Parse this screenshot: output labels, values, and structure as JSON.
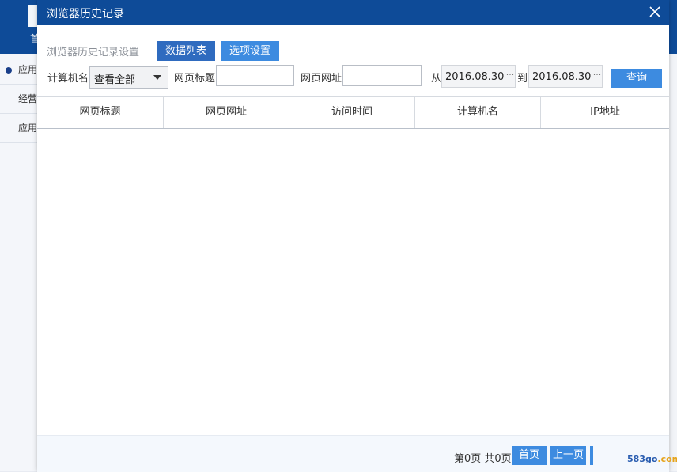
{
  "background": {
    "home_label": "首",
    "sidebar_items": [
      {
        "label": "应用"
      },
      {
        "label": "经营"
      },
      {
        "label": "应用"
      }
    ]
  },
  "dialog": {
    "title": "浏览器历史记录",
    "close_icon": "close-icon",
    "settings_label": "浏览器历史记录设置",
    "tabs": [
      {
        "label": "数据列表",
        "active": true
      },
      {
        "label": "选项设置",
        "active": false
      }
    ],
    "filters": {
      "computer_label": "计算机名",
      "computer_value": "查看全部",
      "page_title_label": "网页标题",
      "page_title_value": "",
      "page_url_label": "网页网址",
      "page_url_value": "",
      "from_label": "从",
      "from_date": "2016.08.30",
      "to_label": "到",
      "to_date": "2016.08.30",
      "date_picker_glyph": "···",
      "query_label": "查询"
    },
    "table": {
      "columns": [
        "网页标题",
        "网页网址",
        "访问时间",
        "计算机名",
        "IP地址"
      ],
      "rows": []
    },
    "pagination": {
      "info": "第0页 共0页",
      "first_label": "首页",
      "prev_label": "上一页"
    }
  },
  "watermark": {
    "main": "583go",
    "accent": ".com"
  },
  "colors": {
    "title_bar": "#0e4b98",
    "tab_active": "#2f6bbf",
    "button": "#3d8be0"
  }
}
